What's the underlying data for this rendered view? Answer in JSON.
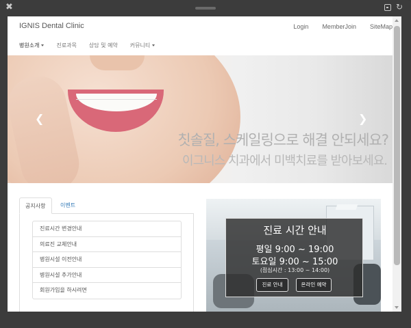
{
  "window": {
    "close_icon": "close-icon",
    "reload_icon": "reload-icon",
    "restore_icon": "window-restore-icon"
  },
  "header": {
    "brand": "IGNIS Dental Clinic",
    "top_links": [
      "Login",
      "MemberJoin",
      "SiteMap"
    ],
    "nav": [
      {
        "label": "병원소개",
        "dropdown": true
      },
      {
        "label": "진료과목",
        "dropdown": false
      },
      {
        "label": "상담 및 예약",
        "dropdown": false
      },
      {
        "label": "커뮤니티",
        "dropdown": true
      }
    ]
  },
  "hero": {
    "headline": "칫솔질, 스케일링으로 해결 안되세요?",
    "subline": "이그니스 치과에서 미백치료를 받아보세요.",
    "prev_icon": "chevron-left-icon",
    "next_icon": "chevron-right-icon"
  },
  "tabs": {
    "items": [
      "공지사항",
      "이벤트"
    ],
    "notices": [
      "진료시간 변경안내",
      "의료진 교체안내",
      "병원시설 이전안내",
      "병원시설 추가안내",
      "회원가입을 하시려면"
    ]
  },
  "hours": {
    "title": "진료 시간 안내",
    "weekday": "평일 9:00 ~ 19:00",
    "saturday": "토요일 9:00 ~ 15:00",
    "lunch": "(점심시간 : 13:00 ~ 14:00)",
    "buttons": [
      "진료 안내",
      "온라인 예약"
    ]
  }
}
